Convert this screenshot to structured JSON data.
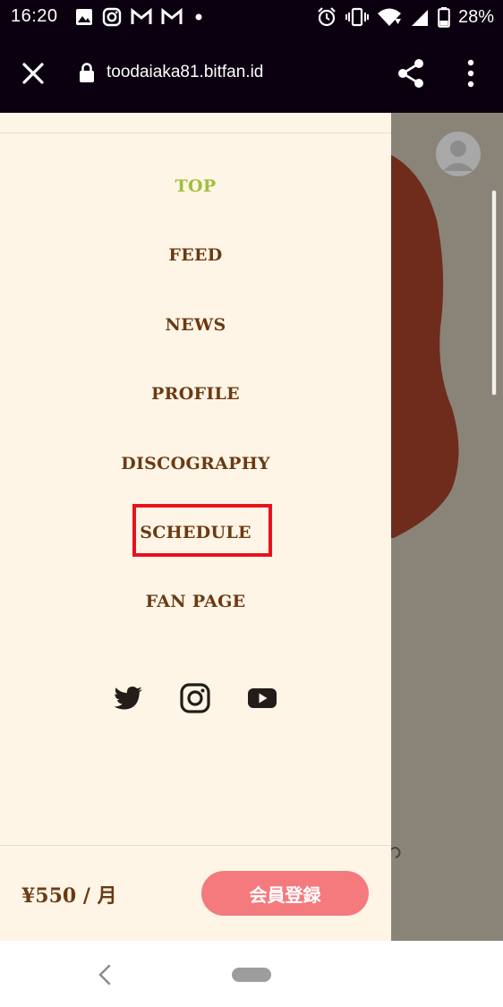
{
  "status_bar": {
    "time": "16:20",
    "battery": "28%",
    "left_icons": [
      "image-icon",
      "instagram-notification-icon",
      "gmail-icon",
      "gmail-icon",
      "dot-icon"
    ],
    "right_icons": [
      "alarm-icon",
      "vibrate-icon",
      "wifi-icon",
      "signal-icon",
      "battery-icon"
    ]
  },
  "browser": {
    "url": "toodaiaka81.bitfan.id"
  },
  "menu": {
    "items": [
      {
        "label": "TOP",
        "active": true
      },
      {
        "label": "FEED",
        "active": false
      },
      {
        "label": "NEWS",
        "active": false
      },
      {
        "label": "PROFILE",
        "active": false
      },
      {
        "label": "DISCOGRAPHY",
        "active": false
      },
      {
        "label": "SCHEDULE",
        "active": false
      },
      {
        "label": "FAN PAGE",
        "active": false
      }
    ],
    "highlighted_item": "SCHEDULE",
    "social": [
      "twitter-icon",
      "instagram-icon",
      "youtube-icon"
    ]
  },
  "footer": {
    "price": "¥550 / 月",
    "signup_label": "会員登録"
  },
  "colors": {
    "menu_text": "#6b3a12",
    "menu_active": "#9fbf3a",
    "drawer_bg": "#fff5e6",
    "signup_bg": "#f47a7e",
    "highlight": "#e8121d",
    "toolbar_bg": "#0a0010"
  }
}
